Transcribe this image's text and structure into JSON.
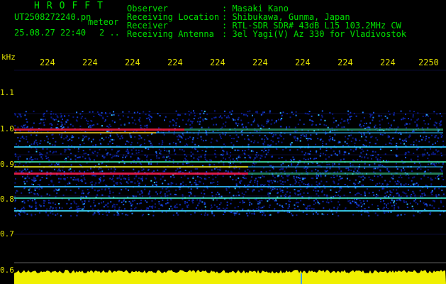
{
  "header": {
    "brand": "HROFFT",
    "filename": "UT2508272240.pn",
    "mode": "meteor",
    "date_time": "25.08.27 22:40",
    "extra": "2 ..",
    "fields": [
      {
        "label": "Observer",
        "value": ": Masaki Kano"
      },
      {
        "label": "Receiving Location",
        "value": ": Shibukawa, Gunma, Japan"
      },
      {
        "label": "Receiver",
        "value": ": RTL-SDR SDR# 43dB L15 103.2MHz CW"
      },
      {
        "label": "Receiving Antenna",
        "value": ": 3el Yagi(V) Az 330 for Vladivostok"
      }
    ]
  },
  "axis": {
    "unit": "kHz",
    "time_ticks": [
      "224",
      "224",
      "224",
      "224",
      "224",
      "224",
      "224",
      "224",
      "224",
      "2250"
    ],
    "freq_ticks": [
      "1.1",
      "1.0",
      "0.9",
      "0.8",
      "0.7",
      "0.6"
    ]
  },
  "colors": {
    "label_yellow": "#e0e000",
    "text_green": "#00e000",
    "background": "#000000",
    "noise_blue": "#1030c0"
  }
}
